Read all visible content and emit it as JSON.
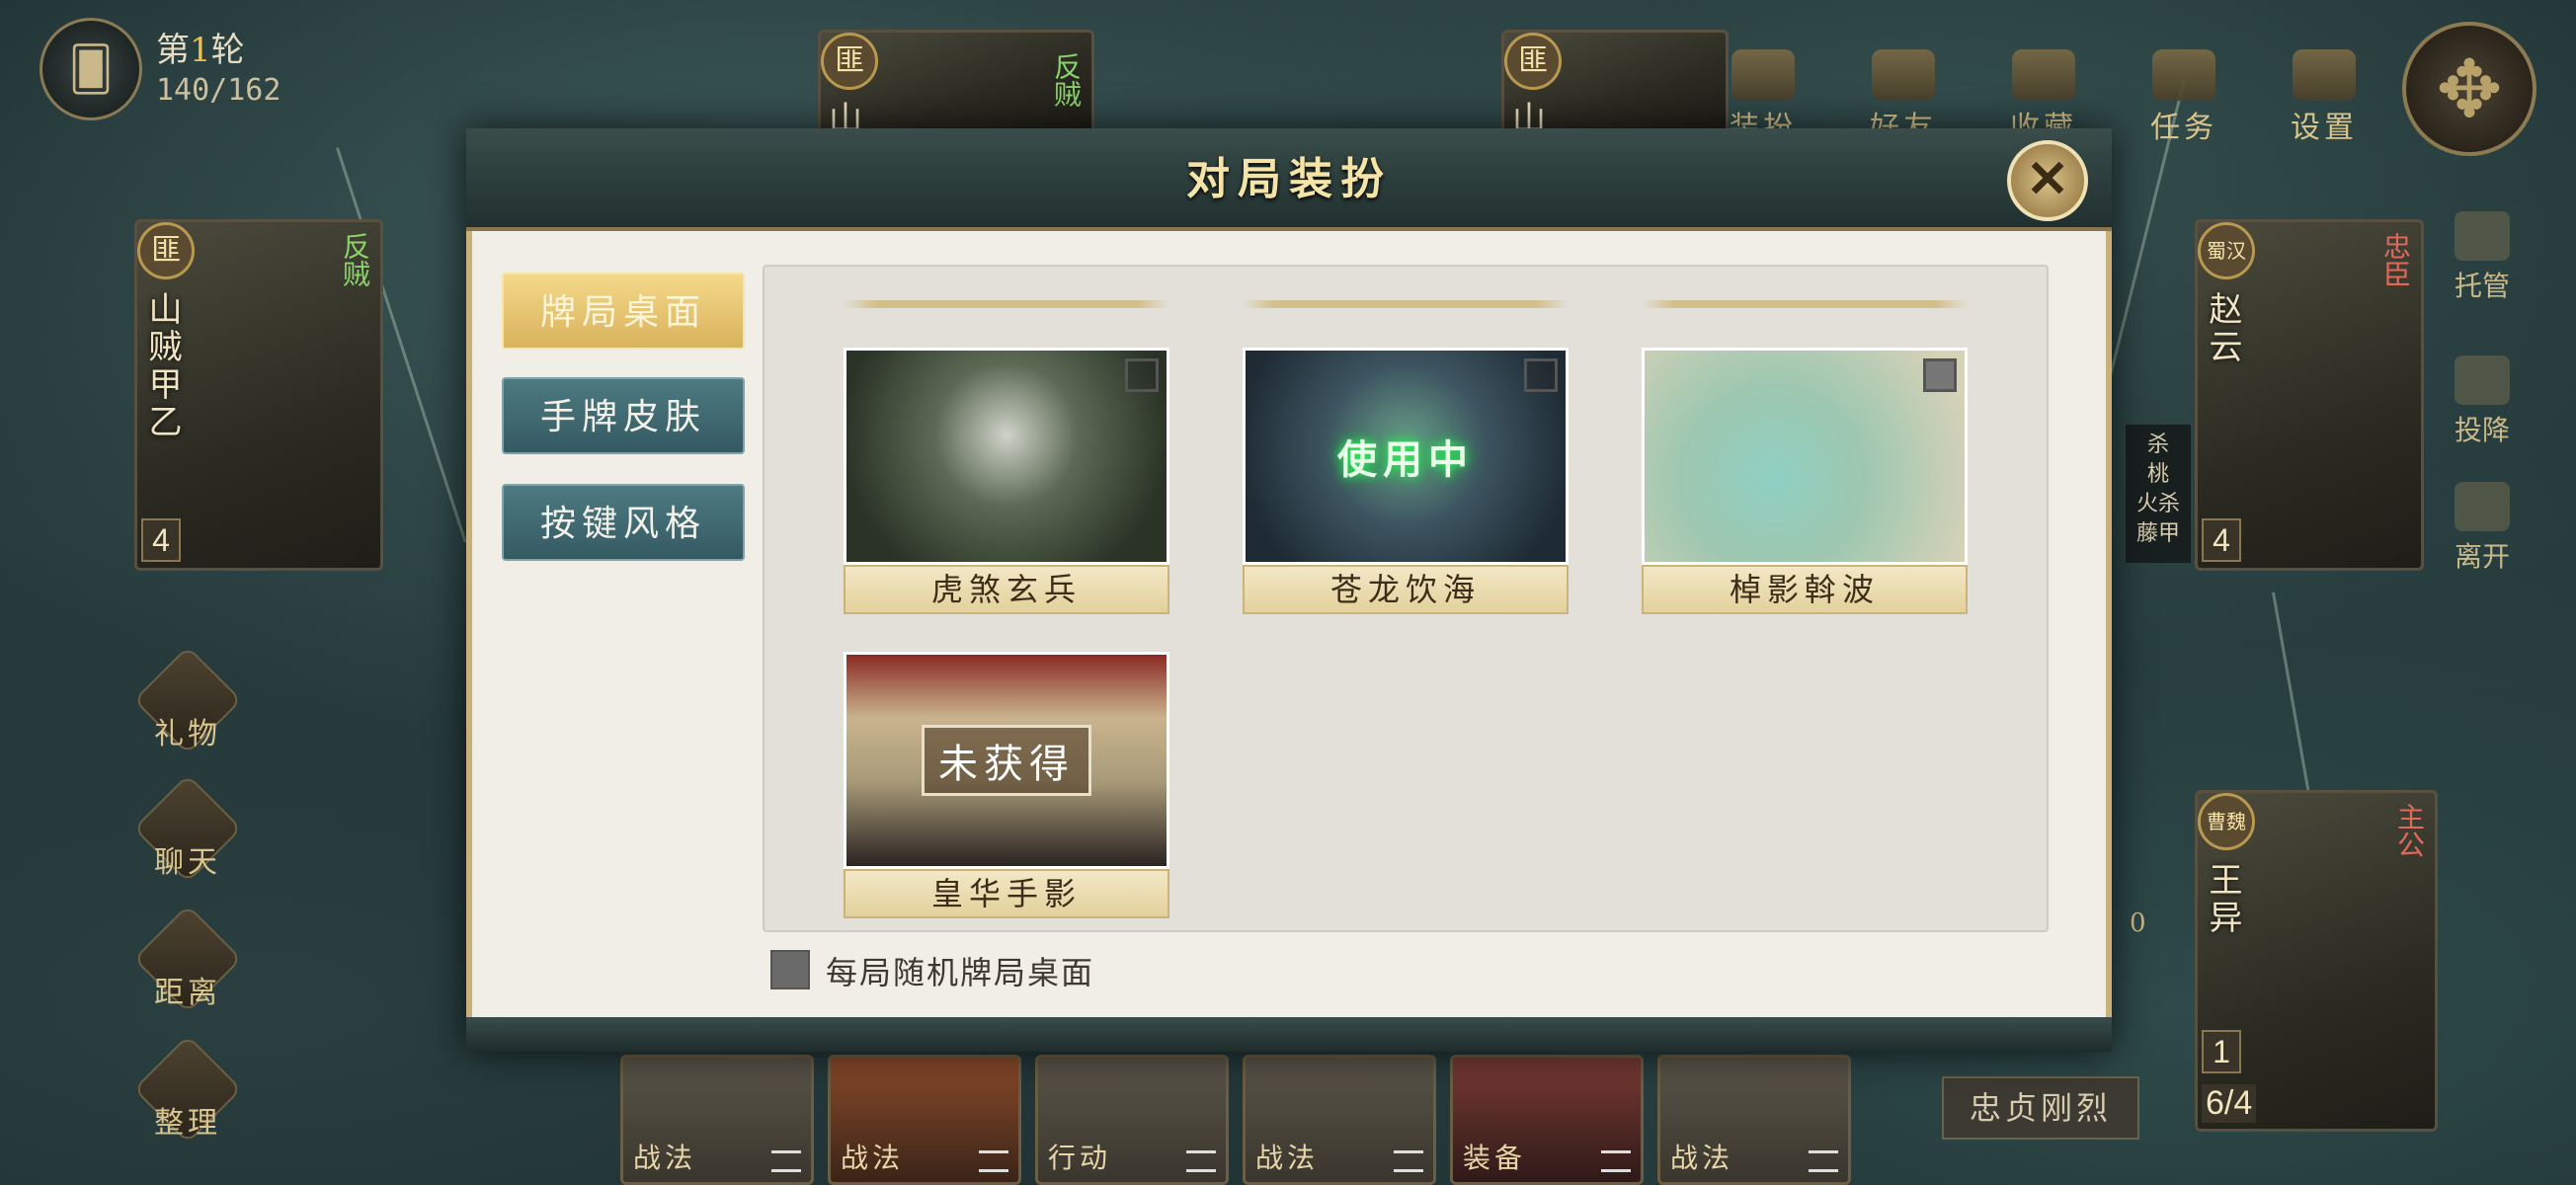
{
  "hud": {
    "round_prefix": "第",
    "round_number": "1",
    "round_suffix": "轮",
    "card_count": "140/162",
    "top_buttons": [
      "装扮",
      "好友",
      "收藏",
      "任务",
      "设置"
    ]
  },
  "players": {
    "left": {
      "title_badge": "匪",
      "name": "山贼甲乙",
      "faction": "反贼",
      "hp": "4"
    },
    "top_left": {
      "title_badge": "匪",
      "name": "山",
      "faction": "反贼"
    },
    "top_right": {
      "title_badge": "匪",
      "name": "山"
    },
    "right": {
      "title_badge": "蜀汉",
      "name": "赵云",
      "faction": "忠臣",
      "hp": "4"
    },
    "self": {
      "title_badge": "曹魏",
      "name": "王异",
      "faction": "主公",
      "hp": "1",
      "hand_count": "6/4"
    }
  },
  "side_buttons": [
    "礼物",
    "聊天",
    "距离",
    "整理"
  ],
  "right_buttons": [
    "托管",
    "投降",
    "离开"
  ],
  "kill_notes": [
    "杀",
    "桃",
    "火杀",
    "藤甲"
  ],
  "hand_cards": [
    "战法",
    "战法",
    "行动",
    "战法",
    "装备",
    "战法"
  ],
  "equip_label": "忠贞刚烈",
  "small_counter": "0",
  "modal": {
    "title": "对局装扮",
    "close_label": "✕",
    "tabs": [
      {
        "label": "牌局桌面",
        "active": true
      },
      {
        "label": "手牌皮肤",
        "active": false
      },
      {
        "label": "按键风格",
        "active": false
      }
    ],
    "skins": [
      {
        "name": "虎煞玄兵",
        "status": ""
      },
      {
        "name": "苍龙饮海",
        "status": "使用中"
      },
      {
        "name": "棹影斡波",
        "status": ""
      },
      {
        "name": "皇华手影",
        "status": "未获得"
      }
    ],
    "random_label": "每局随机牌局桌面"
  },
  "colors": {
    "accent_gold": "#d9b25c",
    "tab_teal": "#4e7a82",
    "in_use_green": "#2aff5a"
  }
}
